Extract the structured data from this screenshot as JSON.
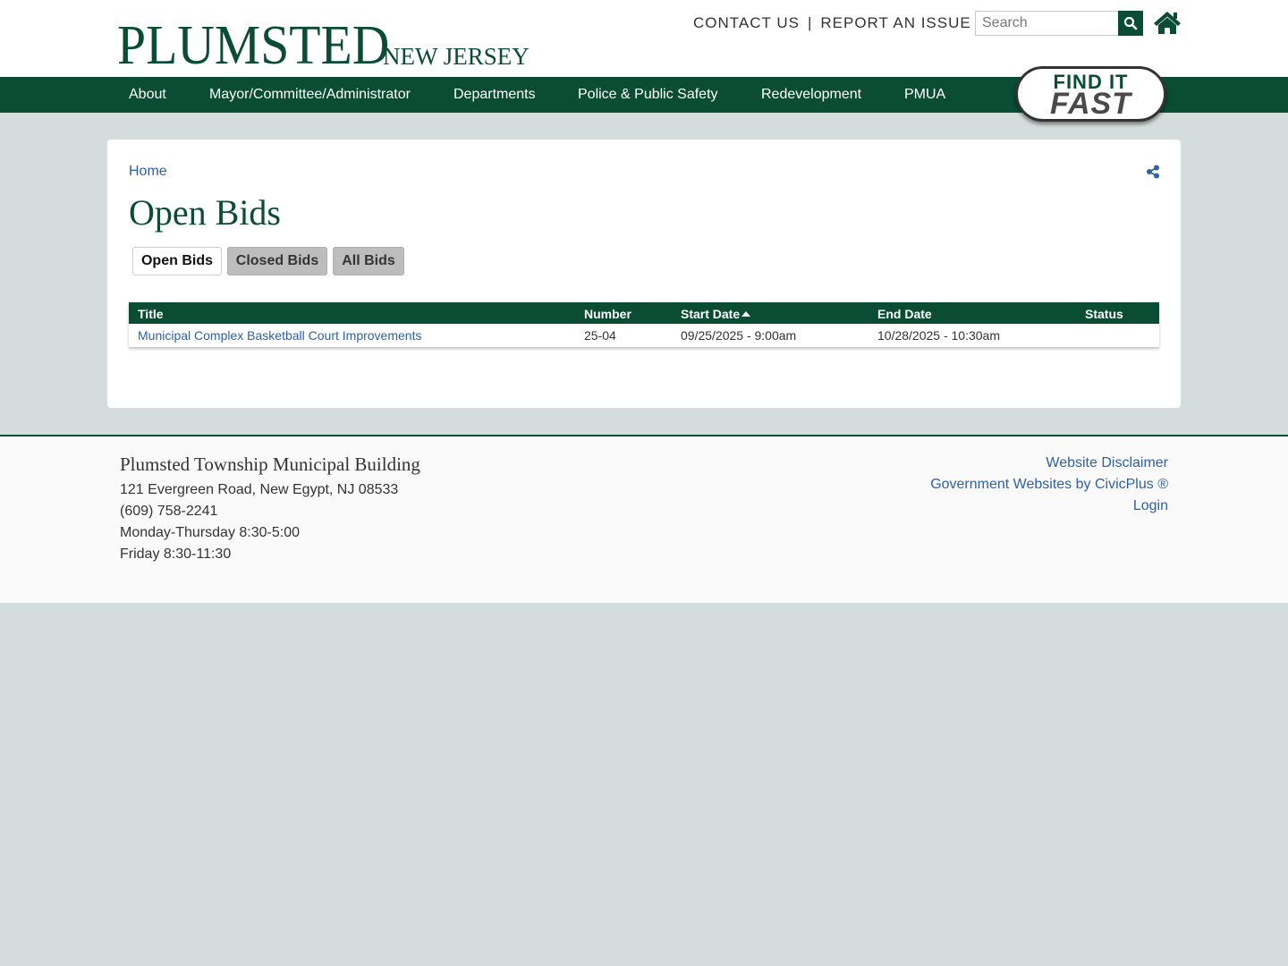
{
  "header": {
    "logo_main": "PLUMSTED",
    "logo_sub": "NEW JERSEY",
    "contact_label": "CONTACT US",
    "separator": "|",
    "report_label": "REPORT AN ISSUE",
    "search_placeholder": "Search"
  },
  "nav": {
    "items": [
      "About",
      "Mayor/Committee/Administrator",
      "Departments",
      "Police & Public Safety",
      "Redevelopment",
      "PMUA"
    ],
    "find_it": "FIND IT",
    "fast": "FAST"
  },
  "page": {
    "breadcrumb": "Home",
    "title": "Open Bids",
    "tabs": [
      {
        "label": "Open Bids",
        "active": true
      },
      {
        "label": "Closed Bids",
        "active": false
      },
      {
        "label": "All Bids",
        "active": false
      }
    ]
  },
  "table": {
    "columns": [
      "Title",
      "Number",
      "Start Date",
      "End Date",
      "Status"
    ],
    "sorted_column": "Start Date",
    "rows": [
      {
        "title": "Municipal Complex Basketball Court Improvements",
        "number": "25-04",
        "start": "09/25/2025 - 9:00am",
        "end": "10/28/2025 - 10:30am",
        "status": ""
      }
    ]
  },
  "footer": {
    "building": "Plumsted Township Municipal Building",
    "address": "121 Evergreen Road, New Egypt, NJ 08533",
    "phone": "(609) 758-2241",
    "hours1": "Monday-Thursday 8:30-5:00",
    "hours2": "Friday 8:30-11:30",
    "links": [
      "Website Disclaimer",
      "Government Websites by CivicPlus ®",
      "Login"
    ]
  },
  "colors": {
    "brand_green": "#0a4d34",
    "link_blue": "#2d61a8",
    "page_bg": "#d4dddb"
  },
  "icons": {
    "search": "search-icon",
    "home": "home-icon",
    "share": "share-icon"
  }
}
